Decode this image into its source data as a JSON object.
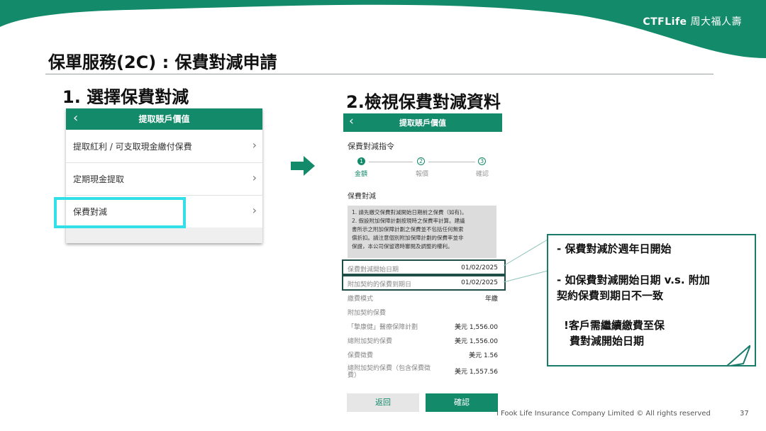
{
  "brand": {
    "logo_latin": "CTFLife",
    "logo_chinese": "周大福人壽",
    "color_primary": "#138a6a",
    "color_highlight": "#33e0e8"
  },
  "slide": {
    "title": "保單服務(2C) : 保費對減申請",
    "step1_title": "1. 選擇保費對減",
    "step2_title": "2.檢視保費對減資料",
    "footer": "i Fook Life Insurance Company Limited © All rights reserved",
    "page_number": "37"
  },
  "screen1": {
    "header_title": "提取賬戶價值",
    "back_icon": "‹",
    "menu_items": [
      {
        "label": "提取紅利 / 可支取現金繳付保費"
      },
      {
        "label": "定期現金提取"
      },
      {
        "label": "保費對減"
      }
    ],
    "chevron": "›"
  },
  "screen2": {
    "header_title": "提取賬戶價值",
    "back_icon": "‹",
    "section_title": "保費對減指令",
    "steps": [
      {
        "num": "1",
        "label": "金額",
        "active": true
      },
      {
        "num": "2",
        "label": "報價",
        "active": false
      },
      {
        "num": "3",
        "label": "確認",
        "active": false
      }
    ],
    "subheading": "保費對減",
    "notice_lines": [
      "1. 請先繳交保費對減開始日期前之保費（如有)。",
      "2. 假設附加保障計劃按現時之保費率計算。建議",
      "書所示之附加保障計劃之保費並不包括任何無索",
      "償折扣。請注意個別附加保障計劃的保費率並非",
      "保證，本公司保留適時審閱及調整的權利。"
    ],
    "rows": [
      {
        "label": "保費對減開始日期",
        "value": "01/02/2025"
      },
      {
        "label": "附加契約的保費到期日",
        "value": "01/02/2025"
      },
      {
        "label": "繳費模式",
        "value": "年繳"
      },
      {
        "label": "附加契約保費",
        "value": ""
      },
      {
        "label": "「摯康健」醫療保障計劃",
        "value": "美元 1,556.00"
      },
      {
        "label": "總附加契約保費",
        "value": "美元 1,556.00"
      },
      {
        "label": "保費徵費",
        "value": "美元 1.56"
      },
      {
        "label": "總附加契約保費（包含保費徵",
        "label2": "費）",
        "value": "美元 1,557.56"
      }
    ],
    "back_button": "返回",
    "confirm_button": "確認"
  },
  "callout": {
    "point1": "- 保費對減於週年日開始",
    "point2_line1": "- 如保費對減開始日期 v.s. 附加",
    "point2_line2": "契約保費到期日不一致",
    "point3_line1": "!客戶需繼續繳費至保",
    "point3_line2": "費對減開始日期"
  }
}
